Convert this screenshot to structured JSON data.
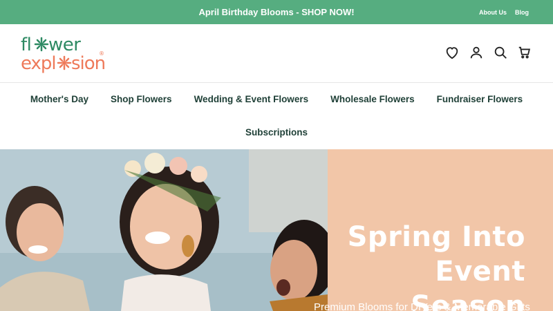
{
  "announcement": {
    "text": "April Birthday Blooms - SHOP NOW!"
  },
  "top_links": [
    {
      "label": "About Us"
    },
    {
      "label": "Blog"
    }
  ],
  "logo": {
    "line1": "flower",
    "line2": "explosion",
    "mark": "®"
  },
  "header_icons": [
    "heart-icon",
    "account-icon",
    "search-icon",
    "cart-icon"
  ],
  "nav": {
    "items": [
      {
        "label": "Mother's Day"
      },
      {
        "label": "Shop Flowers"
      },
      {
        "label": "Wedding & Event Flowers"
      },
      {
        "label": "Wholesale Flowers"
      },
      {
        "label": "Fundraiser Flowers"
      },
      {
        "label": "Subscriptions"
      }
    ]
  },
  "hero": {
    "title_line1": "Spring Into",
    "title_line2": "Event Season",
    "subtitle": "Premium Blooms for DIYers & Memorable Gifts"
  },
  "colors": {
    "announce_bg": "#56ad80",
    "brand_green": "#2e8a63",
    "brand_coral": "#ee7a5a",
    "nav_text": "#1e3f36",
    "hero_panel": "#f2c6a8"
  }
}
